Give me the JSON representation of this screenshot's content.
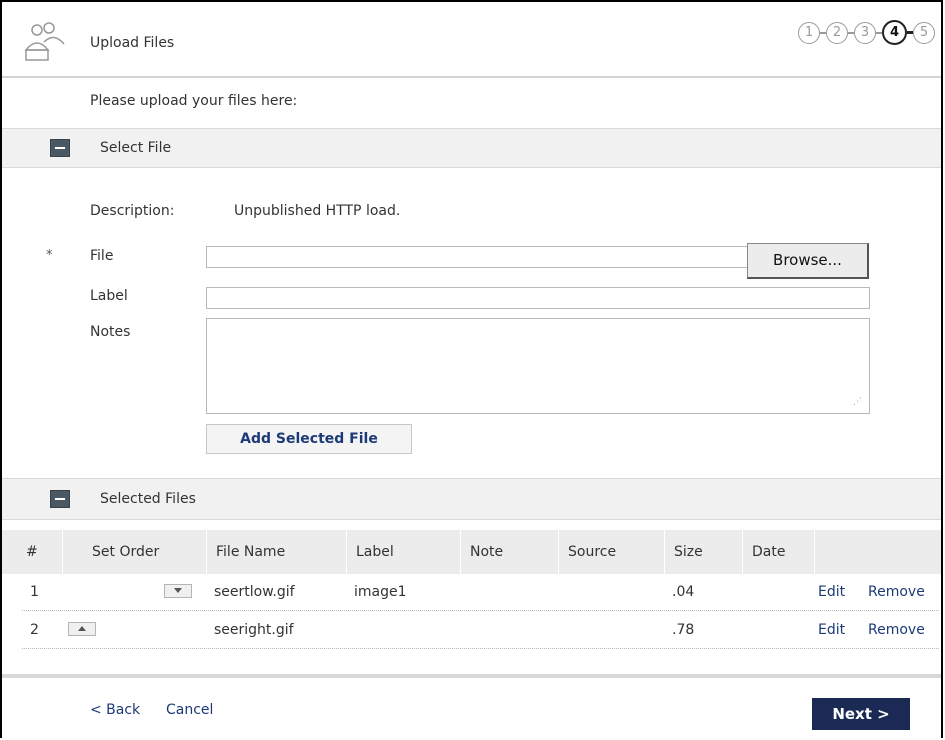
{
  "header": {
    "title": "Upload Files",
    "steps": [
      "1",
      "2",
      "3",
      "4",
      "5"
    ],
    "active_step": "4"
  },
  "intro": "Please upload your files here:",
  "select_section": {
    "title": "Select File",
    "description_label": "Description:",
    "description_value": "Unpublished HTTP load.",
    "required_marker": "*",
    "file_label": "File",
    "file_value": "",
    "browse_label": "Browse...",
    "label_label": "Label",
    "label_value": "",
    "notes_label": "Notes",
    "notes_value": "",
    "add_button": "Add Selected File"
  },
  "selected_section": {
    "title": "Selected Files",
    "columns": [
      "#",
      "Set Order",
      "File Name",
      "Label",
      "Note",
      "Source",
      "Size",
      "Date",
      ""
    ],
    "rows": [
      {
        "num": "1",
        "order": "down",
        "file_name": "seertlow.gif",
        "label": "image1",
        "note": "",
        "source": "",
        "size": ".04",
        "date": "",
        "edit": "Edit",
        "remove": "Remove"
      },
      {
        "num": "2",
        "order": "up",
        "file_name": "seeright.gif",
        "label": "",
        "note": "",
        "source": "",
        "size": ".78",
        "date": "",
        "edit": "Edit",
        "remove": "Remove"
      }
    ]
  },
  "footer": {
    "back": "< Back",
    "cancel": "Cancel",
    "next": "Next >"
  },
  "colors": {
    "accent": "#1a2a55",
    "link": "#1c3a78",
    "section_bg": "#f1f1f1"
  }
}
